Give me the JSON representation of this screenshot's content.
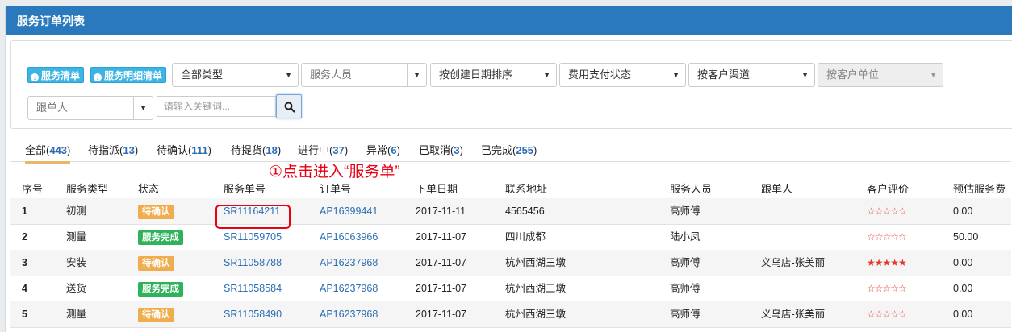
{
  "panel": {
    "title": "服务订单列表"
  },
  "filters": {
    "btn_service_list": "服务清单",
    "btn_service_detail_list": "服务明细清单",
    "type_select": "全部类型",
    "staff_select": "服务人员",
    "sort_select": "按创建日期排序",
    "payment_select": "费用支付状态",
    "channel_select": "按客户渠道",
    "unit_select": "按客户单位",
    "follower_select": "跟单人",
    "search_placeholder": "请输入关键词..."
  },
  "tabs": [
    {
      "label": "全部(",
      "count": "443",
      "close": ")"
    },
    {
      "label": "待指派(",
      "count": "13",
      "close": ")"
    },
    {
      "label": "待确认(",
      "count": "111",
      "close": ")"
    },
    {
      "label": "待提货(",
      "count": "18",
      "close": ")"
    },
    {
      "label": "进行中(",
      "count": "37",
      "close": ")"
    },
    {
      "label": "异常(",
      "count": "6",
      "close": ")"
    },
    {
      "label": "已取消(",
      "count": "3",
      "close": ")"
    },
    {
      "label": "已完成(",
      "count": "255",
      "close": ")"
    }
  ],
  "annotation": "①点击进入“服务单”",
  "table": {
    "headers": [
      "序号",
      "服务类型",
      "状态",
      "服务单号",
      "订单号",
      "下单日期",
      "联系地址",
      "服务人员",
      "跟单人",
      "客户评价",
      "预估服务费"
    ],
    "rows": [
      {
        "idx": "1",
        "type": "初测",
        "status": "待确认",
        "status_kind": "warn",
        "service_no": "SR11164211",
        "order_no": "AP16399441",
        "date": "2017-11-11",
        "address": "4565456",
        "staff": "高师傅",
        "follower": "",
        "rating_stars": "☆☆☆☆☆",
        "rating": 0,
        "fee": "0.00"
      },
      {
        "idx": "2",
        "type": "测量",
        "status": "服务完成",
        "status_kind": "ok",
        "service_no": "SR11059705",
        "order_no": "AP16063966",
        "date": "2017-11-07",
        "address": "四川成都",
        "staff": "陆小凤",
        "follower": "",
        "rating_stars": "☆☆☆☆☆",
        "rating": 0,
        "fee": "50.00"
      },
      {
        "idx": "3",
        "type": "安装",
        "status": "待确认",
        "status_kind": "warn",
        "service_no": "SR11058788",
        "order_no": "AP16237968",
        "date": "2017-11-07",
        "address": "杭州西湖三墩",
        "staff": "高师傅",
        "follower": "义乌店-张美丽",
        "rating_stars": "★★★★★",
        "rating": 5,
        "fee": "0.00"
      },
      {
        "idx": "4",
        "type": "送货",
        "status": "服务完成",
        "status_kind": "ok",
        "service_no": "SR11058584",
        "order_no": "AP16237968",
        "date": "2017-11-07",
        "address": "杭州西湖三墩",
        "staff": "高师傅",
        "follower": "",
        "rating_stars": "☆☆☆☆☆",
        "rating": 0,
        "fee": "0.00"
      },
      {
        "idx": "5",
        "type": "测量",
        "status": "待确认",
        "status_kind": "warn",
        "service_no": "SR11058490",
        "order_no": "AP16237968",
        "date": "2017-11-07",
        "address": "杭州西湖三墩",
        "staff": "高师傅",
        "follower": "义乌店-张美丽",
        "rating_stars": "☆☆☆☆☆",
        "rating": 0,
        "fee": "0.00"
      }
    ]
  },
  "colors": {
    "header": "#2a79bd",
    "link": "#2a6db3",
    "warn_badge": "#f0ad4e",
    "ok_badge": "#2fb35a",
    "annotation": "#e60012"
  }
}
